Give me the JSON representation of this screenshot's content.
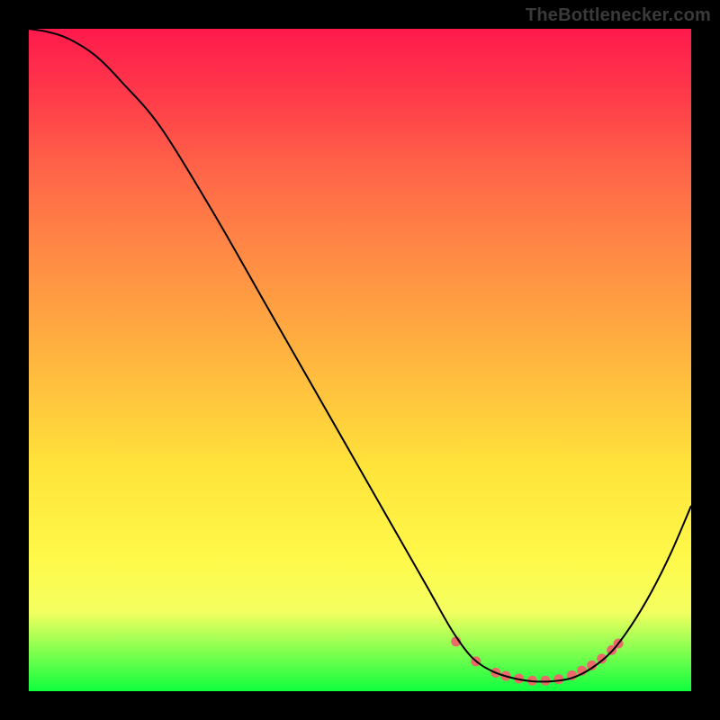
{
  "watermark": {
    "text": "TheBottlenecker.com"
  },
  "chart_data": {
    "type": "line",
    "title": "",
    "xlabel": "",
    "ylabel": "",
    "xlim": [
      0,
      100
    ],
    "ylim": [
      0,
      100
    ],
    "grid": false,
    "series": [
      {
        "name": "curve",
        "color": "#000000",
        "x": [
          0,
          3,
          6,
          10,
          14,
          20,
          28,
          36,
          44,
          52,
          60,
          64,
          67,
          70,
          73,
          76,
          79,
          82,
          85,
          88,
          91,
          94,
          97,
          100
        ],
        "y": [
          100,
          99.5,
          98.5,
          96,
          92,
          85,
          72,
          58,
          44,
          30,
          16,
          9,
          5,
          3,
          2,
          1.5,
          1.5,
          2,
          3.5,
          6,
          10,
          15,
          21,
          28
        ]
      },
      {
        "name": "markers",
        "type": "scatter",
        "color": "#ea6a6a",
        "x": [
          64.5,
          67.5,
          70.5,
          72,
          74,
          76,
          78,
          80,
          82,
          83.5,
          85,
          86.5,
          88,
          89
        ],
        "y": [
          7.5,
          4.5,
          2.8,
          2.3,
          1.9,
          1.6,
          1.6,
          1.8,
          2.4,
          3.1,
          3.9,
          4.9,
          6.2,
          7.2
        ]
      }
    ],
    "gradient_stops": [
      {
        "pos": 0,
        "color": "#ff1a4d"
      },
      {
        "pos": 10,
        "color": "#ff3a4a"
      },
      {
        "pos": 22,
        "color": "#ff6748"
      },
      {
        "pos": 34,
        "color": "#ff8a45"
      },
      {
        "pos": 48,
        "color": "#ffb040"
      },
      {
        "pos": 66,
        "color": "#ffe33a"
      },
      {
        "pos": 80,
        "color": "#fff94a"
      },
      {
        "pos": 88,
        "color": "#f4ff60"
      },
      {
        "pos": 100,
        "color": "#0fff3f"
      }
    ]
  }
}
